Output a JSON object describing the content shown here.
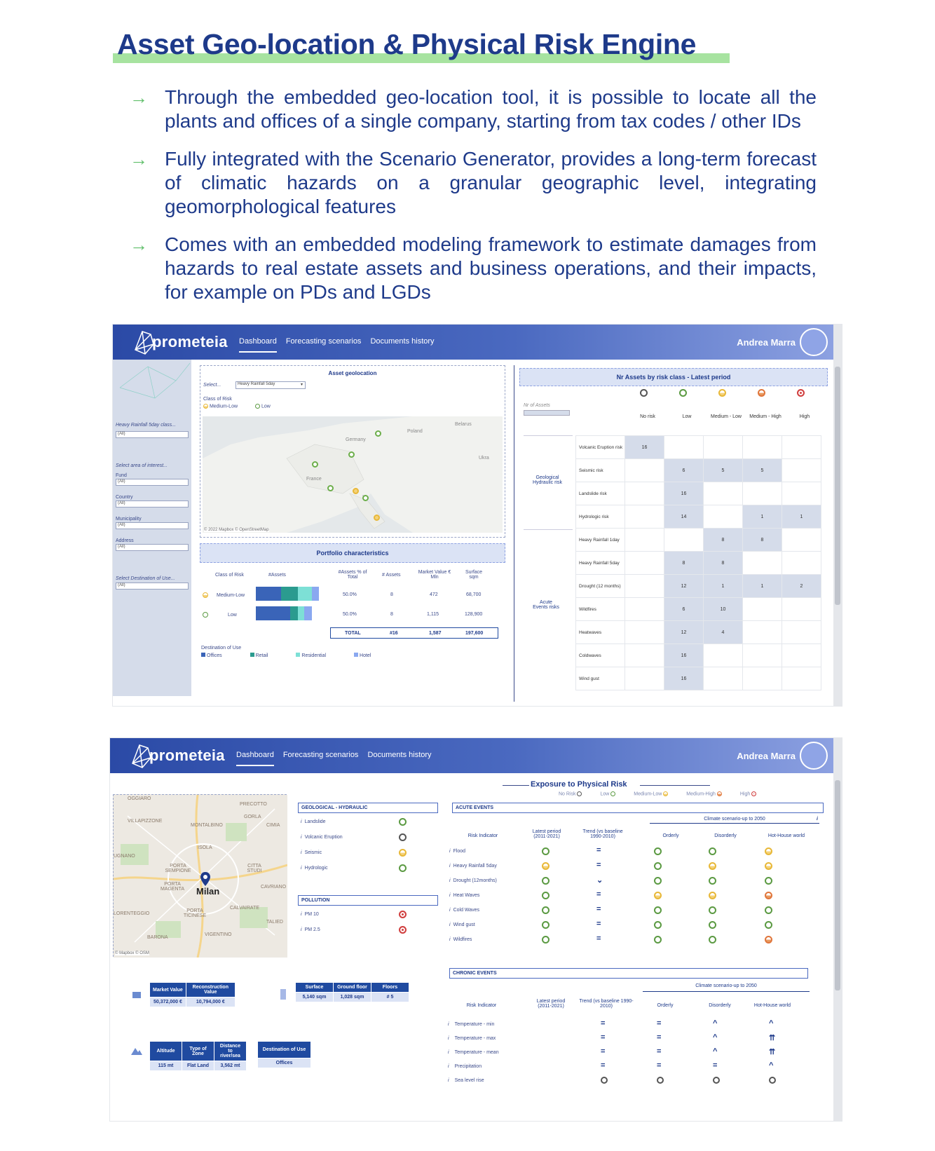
{
  "title": "Asset Geo-location & Physical Risk Engine",
  "bullets": [
    "Through the embedded geo-location tool, it is possible to locate all the plants and offices of a single company, starting from tax codes / other IDs",
    "Fully integrated with the Scenario Generator, provides a long-term forecast of climatic hazards on a granular geographic level, integrating geomorphological features",
    "Comes with an embedded modeling framework to estimate damages from hazards to real estate assets and business operations, and their impacts, for example on PDs and LGDs"
  ],
  "nav": {
    "brand": "prometeia",
    "links": [
      "Dashboard",
      "Forecasting scenarios",
      "Documents history"
    ],
    "user": "Andrea Marra"
  },
  "shot1": {
    "sidebar": {
      "filter1_label": "Heavy Rainfall 5day class...",
      "filter1_value": "(All)",
      "area_label": "Select area of interest...",
      "fund_label": "Fund",
      "fund_value": "(All)",
      "country_label": "Country",
      "country_value": "(All)",
      "municipality_label": "Municipality",
      "municipality_value": "(All)",
      "address_label": "Address",
      "address_value": "(All)",
      "dest_label": "Select Destination of Use...",
      "dest_value": "(All)"
    },
    "geo": {
      "title": "Asset geolocation",
      "select_label": "Select...",
      "select_value": "Heavy Rainfall 5day",
      "class_label": "Class of Risk",
      "legend_ml": "Medium-Low",
      "legend_low": "Low",
      "map_labels": {
        "germany": "Germany",
        "poland": "Poland",
        "belarus": "Belarus",
        "france": "France",
        "ukraine": "Ukra",
        "italy": "It"
      },
      "attribution": "© 2022 Mapbox © OpenStreetMap"
    },
    "portfolio": {
      "title": "Portfolio characteristics",
      "headers": [
        "Class of Risk",
        "#Assets",
        "#Assets % of Total",
        "# Assets",
        "Market Value € Mln",
        "Surface sqm"
      ],
      "rows": [
        {
          "class": "Medium-Low",
          "pct": "50.0%",
          "n": "8",
          "mv": "472",
          "surface": "68,700"
        },
        {
          "class": "Low",
          "pct": "50.0%",
          "n": "8",
          "mv": "1,115",
          "surface": "128,900"
        }
      ],
      "total": {
        "label": "TOTAL",
        "n": "#16",
        "mv": "1,587",
        "surface": "197,600"
      },
      "dest_label": "Destination of Use",
      "dest_legend": [
        "Offices",
        "Retail",
        "Residential",
        "Hotel"
      ]
    },
    "risk": {
      "title": "Nr Assets by risk class - Latest period",
      "nr_label": "Nr of Assets",
      "classes": [
        "No risk",
        "Low",
        "Medium - Low",
        "Medium - High",
        "High"
      ],
      "group1": "Geological Hydraulic risk",
      "group2": "Acute Events risks",
      "rows": [
        {
          "name": "Volcanic Eruption risk",
          "vals": [
            "16",
            "",
            "",
            "",
            ""
          ]
        },
        {
          "name": "Seismic risk",
          "vals": [
            "",
            "6",
            "5",
            "5",
            ""
          ]
        },
        {
          "name": "Landslide risk",
          "vals": [
            "",
            "16",
            "",
            "",
            ""
          ]
        },
        {
          "name": "Hydrologic risk",
          "vals": [
            "",
            "14",
            "",
            "1",
            "1"
          ]
        },
        {
          "name": "Heavy Rainfall 1day",
          "vals": [
            "",
            "",
            "8",
            "8",
            ""
          ]
        },
        {
          "name": "Heavy Rainfall 5day",
          "vals": [
            "",
            "8",
            "8",
            "",
            ""
          ]
        },
        {
          "name": "Drought (12 months)",
          "vals": [
            "",
            "12",
            "1",
            "1",
            "2"
          ]
        },
        {
          "name": "Wildfires",
          "vals": [
            "",
            "6",
            "10",
            "",
            ""
          ]
        },
        {
          "name": "Heatwaves",
          "vals": [
            "",
            "12",
            "4",
            "",
            ""
          ]
        },
        {
          "name": "Coldwaves",
          "vals": [
            "",
            "16",
            "",
            "",
            ""
          ]
        },
        {
          "name": "Wind gust",
          "vals": [
            "",
            "16",
            "",
            "",
            ""
          ]
        }
      ]
    }
  },
  "shot2": {
    "exposure_title": "Exposure to Physical Risk",
    "legend": [
      "No Risk",
      "Low",
      "Medium-Low",
      "Medium-High",
      "High"
    ],
    "map": {
      "city": "Milan",
      "attribution": "© Mapbox © OSM",
      "districts": [
        "OGGIARO",
        "VILLAPIZZONE",
        "MONTALBINO",
        "PRECOTTO",
        "GORLA",
        "ISOLA",
        "PORTA SEMPIONE",
        "PORTA MAGENTA",
        "CITTA STUDI",
        "CAVRIANO",
        "PORTA TICINESE",
        "CALVAIRATE",
        "LORENTEGGIO",
        "BARONA",
        "VIGENTINO",
        "UGNANO",
        "TALIED",
        "CIMIA"
      ]
    },
    "geo_hydraulic": {
      "title": "GEOLOGICAL - HYDRAULIC",
      "items": [
        "Landslide",
        "Volcanic Eruption",
        "Seismic",
        "Hydrologic"
      ]
    },
    "pollution": {
      "title": "POLLUTION",
      "items": [
        "PM 10",
        "PM 2.5"
      ]
    },
    "acute": {
      "title": "ACUTE EVENTS",
      "scenario": "Climate scenario-up to 2050",
      "headers": [
        "Risk Indicator",
        "Latest period (2011-2021)",
        "Trend (vs baseline 1990-2010)",
        "Orderly",
        "Disorderly",
        "Hot-House world"
      ],
      "items": [
        "Flood",
        "Heavy Rainfall 5day",
        "Drought (12months)",
        "Heat Waves",
        "Cold Waves",
        "Wind gust",
        "Wildfires"
      ]
    },
    "chronic": {
      "title": "CHRONIC EVENTS",
      "scenario": "Climate scenario-up to 2050",
      "headers": [
        "Risk Indicator",
        "Latest period (2011-2021)",
        "Trend (vs baseline 1990-2010)",
        "Orderly",
        "Disorderly",
        "Hot-House world"
      ],
      "items": [
        "Temperature - min",
        "Temperature - max",
        "Temperature - mean",
        "Precipitation",
        "Sea level rise"
      ]
    },
    "kpi1": {
      "headers": [
        "Market Value",
        "Reconstruction Value"
      ],
      "values": [
        "50,372,000 €",
        "10,794,000 €"
      ]
    },
    "kpi2": {
      "headers": [
        "Surface",
        "Ground floor",
        "Floors"
      ],
      "values": [
        "5,140 sqm",
        "1,028 sqm",
        "# 5"
      ]
    },
    "kpi3": {
      "headers": [
        "Altitude",
        "Type of Zone",
        "Distance to river/sea"
      ],
      "values": [
        "115 mt",
        "Flat Land",
        "3,562 mt"
      ]
    },
    "kpi4": {
      "headers": [
        "Destination of Use"
      ],
      "values": [
        "Offices"
      ]
    }
  }
}
